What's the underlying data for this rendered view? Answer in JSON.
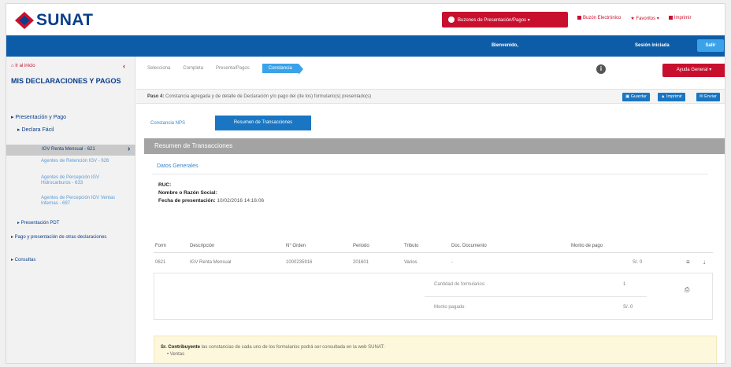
{
  "header": {
    "logo_text": "SUNAT",
    "buzon_label": "Buzones de Presentación/Pagos ▾",
    "links": [
      {
        "label": "Buzón Electrónico"
      },
      {
        "label": "★ Favoritos ▾"
      },
      {
        "label": "Imprimir"
      }
    ]
  },
  "userbar": {
    "welcome": "Bienvenido,",
    "user": "Sesión iniciada",
    "salir": "Salir"
  },
  "sidebar": {
    "home": "Ir al inicio",
    "collapse": "‹",
    "title": "MIS DECLARACIONES Y PAGOS",
    "items": [
      {
        "label": "▸ Presentación y Pago"
      },
      {
        "label": "▸ Declara Fácil"
      },
      {
        "label": "IGV Renta Mensual - 621"
      },
      {
        "label": "Agentes de Retención IGV - 626"
      },
      {
        "label": "Agentes de Percepción IGV Hidrocarburos - 633"
      },
      {
        "label": "Agentes de Percepción IGV Ventas Internas - 697"
      },
      {
        "label": "▸ Presentación PDT"
      },
      {
        "label": "▸ Pago y presentación de otras declaraciones"
      },
      {
        "label": "▸ Consultas"
      }
    ]
  },
  "breadcrumb": {
    "steps": [
      "Selecciona",
      "Completa",
      "Presenta/Pagos",
      "Constancia"
    ]
  },
  "help": {
    "info_glyph": "i",
    "ayuda_label": "Ayuda General ▾"
  },
  "paso": {
    "bold": "Paso 4:",
    "text": "Constancia agregada y de detalle de Declaración y/o pago del (de los) formulario(s) presentado(s)",
    "buttons": [
      {
        "label": "Guardar"
      },
      {
        "label": "Imprimir"
      },
      {
        "label": "Enviar"
      }
    ]
  },
  "tabs": {
    "nps": "Constancia NPS",
    "active": "Resumen de Transacciones"
  },
  "section_title": "Resumen de Transacciones",
  "datos": {
    "title": "Datos Generales",
    "ruc_label": "RUC:",
    "ruc_value": "",
    "nombre_label": "Nombre o Razón Social:",
    "nombre_value": "",
    "fecha_label": "Fecha de presentación:",
    "fecha_value": "10/02/2016 14:16:06"
  },
  "table": {
    "headers": [
      "Form",
      "Descripción",
      "N° Orden",
      "Periodo",
      "Tributo",
      "Doc. Documento",
      "Monto de pago"
    ],
    "rows": [
      [
        "0621",
        "IGV Renta Mensual",
        "1000235916",
        "201601",
        "Varios",
        "-",
        "S/. 0"
      ]
    ],
    "row_icons": [
      "≡",
      "↓"
    ]
  },
  "summary": {
    "cantidad_label": "Cantidad de formularios:",
    "cantidad_value": "1",
    "monto_label": "Monto pagado:",
    "monto_value": "S/. 0",
    "print_glyph": "⎙"
  },
  "note": {
    "bold": "Sr. Contribuyente",
    "text": "las constancias de cada uno de los formularios podrá ser consultada en la web SUNAT:",
    "bullet": "• Ventas"
  },
  "colors": {
    "brand_blue": "#0a3f8a",
    "bar_blue": "#0d5ca8",
    "accent_red": "#c8102e",
    "light_blue": "#3aa2e8"
  }
}
